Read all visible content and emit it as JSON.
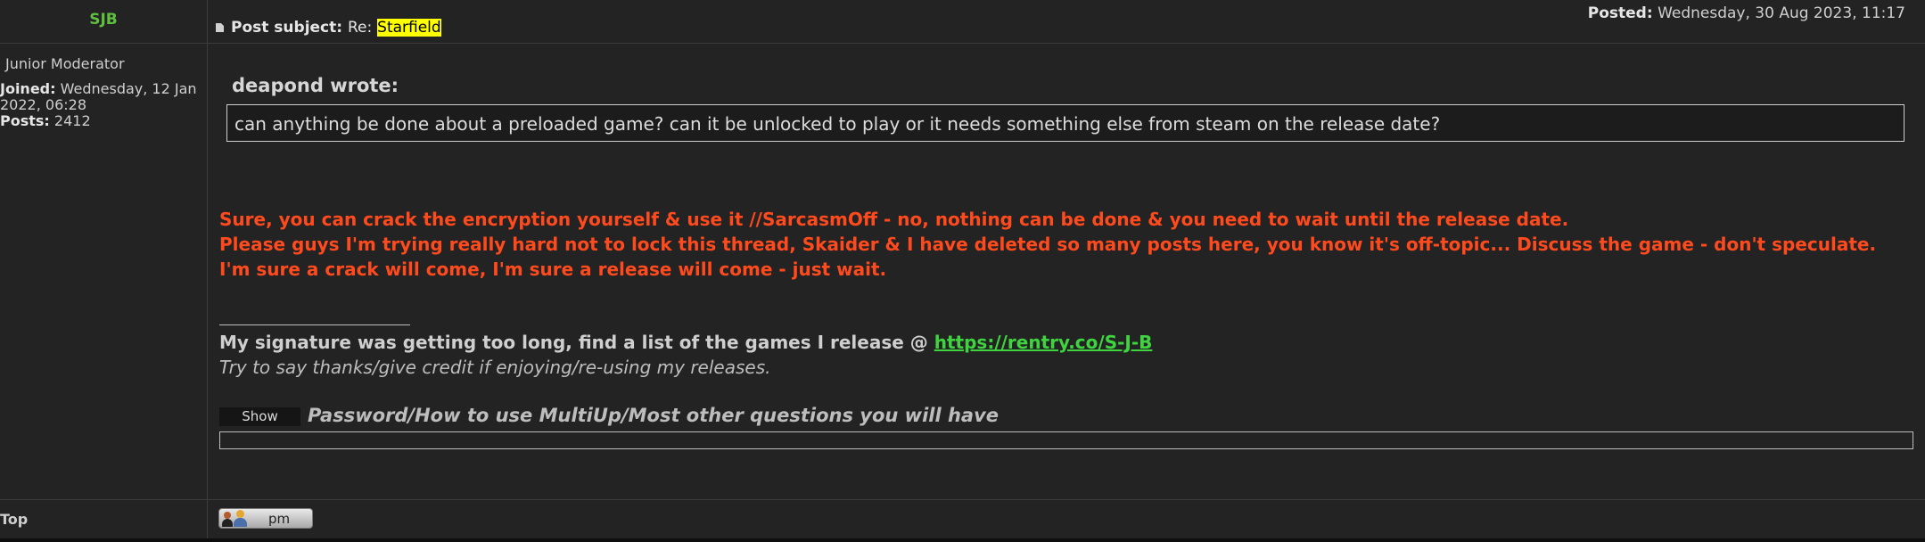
{
  "header": {
    "author": "SJB",
    "subject_label": "Post subject:",
    "subject_prefix": "Re:",
    "subject_highlight": "Starfield",
    "posted_label": "Posted:",
    "posted_value": "Wednesday, 30 Aug 2023, 11:17"
  },
  "profile": {
    "rank": "Junior Moderator",
    "joined_label": "Joined:",
    "joined_value": "Wednesday, 12 Jan 2022, 06:28",
    "posts_label": "Posts:",
    "posts_value": "2412"
  },
  "quote": {
    "author": "deapond wrote:",
    "text": "can anything be done about a preloaded game? can it be unlocked to play or it needs something else from steam on the release date?"
  },
  "body": {
    "line1": "Sure, you can crack the encryption yourself & use it //SarcasmOff - no, nothing can be done & you need to wait until the release date.",
    "line2": "Please guys I'm trying really hard not to lock this thread, Skaider & I have deleted so many posts here, you know it's off-topic... Discuss the game - don't speculate.",
    "line3": "I'm sure a crack will come, I'm sure a release will come - just wait."
  },
  "signature": {
    "text": "My signature was getting too long, find a list of the games I release @",
    "link": "https://rentry.co/S-J-B",
    "italic": "Try to say thanks/give credit if enjoying/re-using my releases."
  },
  "spoiler": {
    "button": "Show",
    "title": "Password/How to use MultiUp/Most other questions you will have"
  },
  "footer": {
    "top": "Top",
    "pm": "pm"
  },
  "colors": {
    "background": "#232323",
    "author": "#5fbf3f",
    "emphasis": "#ff4a1e",
    "link": "#3fd43f",
    "highlight": "#ffff00"
  }
}
